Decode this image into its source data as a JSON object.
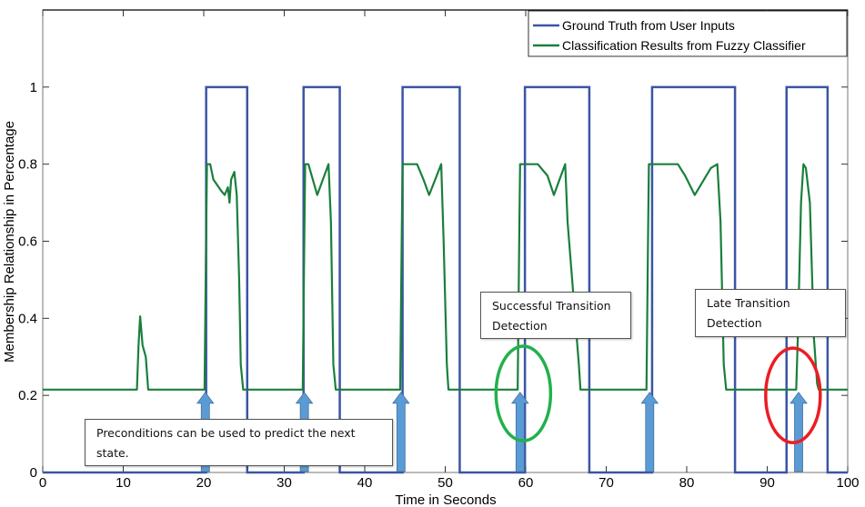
{
  "chart_data": {
    "type": "line",
    "title": "",
    "xlabel": "Time in Seconds",
    "ylabel": "Membership Relationship in Percentage",
    "xlim": [
      0,
      100
    ],
    "ylim": [
      0,
      1.2
    ],
    "xticks": [
      0,
      10,
      20,
      30,
      40,
      50,
      60,
      70,
      80,
      90,
      100
    ],
    "yticks": [
      0,
      0.2,
      0.4,
      0.6,
      0.8,
      1
    ],
    "ytick_labels": [
      "0",
      "0.2",
      "0.4",
      "0.6",
      "0.8",
      "1"
    ],
    "grid": false,
    "legend": {
      "placement": "top-right",
      "entries": [
        {
          "label": "Ground Truth from User Inputs",
          "color": "#3a55a4"
        },
        {
          "label": "Classification Results from Fuzzy Classifier",
          "color": "#1a7f3c"
        }
      ]
    },
    "series": [
      {
        "name": "Ground Truth from User Inputs",
        "color": "#3a55a4",
        "pulses": [
          [
            20.3,
            25.4
          ],
          [
            32.4,
            36.9
          ],
          [
            44.7,
            51.8
          ],
          [
            59.9,
            67.9
          ],
          [
            75.7,
            86.0
          ],
          [
            92.4,
            97.5
          ]
        ],
        "low": 0,
        "high": 1
      },
      {
        "name": "Classification Results from Fuzzy Classifier",
        "color": "#1a7f3c",
        "points": [
          [
            0,
            0.215
          ],
          [
            11.7,
            0.215
          ],
          [
            11.9,
            0.33
          ],
          [
            12.1,
            0.405
          ],
          [
            12.4,
            0.33
          ],
          [
            12.8,
            0.3
          ],
          [
            13.1,
            0.215
          ],
          [
            20.1,
            0.215
          ],
          [
            20.3,
            0.62
          ],
          [
            20.4,
            0.8
          ],
          [
            20.8,
            0.8
          ],
          [
            21.2,
            0.76
          ],
          [
            22.2,
            0.73
          ],
          [
            22.6,
            0.72
          ],
          [
            23.0,
            0.74
          ],
          [
            23.2,
            0.7
          ],
          [
            23.4,
            0.76
          ],
          [
            23.8,
            0.78
          ],
          [
            24.1,
            0.72
          ],
          [
            24.4,
            0.5
          ],
          [
            24.6,
            0.28
          ],
          [
            24.9,
            0.215
          ],
          [
            32.3,
            0.215
          ],
          [
            32.5,
            0.62
          ],
          [
            32.6,
            0.8
          ],
          [
            33.0,
            0.8
          ],
          [
            34.1,
            0.72
          ],
          [
            35.5,
            0.8
          ],
          [
            35.8,
            0.65
          ],
          [
            36.1,
            0.28
          ],
          [
            36.4,
            0.215
          ],
          [
            44.4,
            0.215
          ],
          [
            44.6,
            0.62
          ],
          [
            44.7,
            0.8
          ],
          [
            46.5,
            0.8
          ],
          [
            47.3,
            0.76
          ],
          [
            48.0,
            0.72
          ],
          [
            49.5,
            0.8
          ],
          [
            49.8,
            0.6
          ],
          [
            50.2,
            0.28
          ],
          [
            50.4,
            0.215
          ],
          [
            59.0,
            0.215
          ],
          [
            59.2,
            0.62
          ],
          [
            59.3,
            0.8
          ],
          [
            61.5,
            0.8
          ],
          [
            62.7,
            0.77
          ],
          [
            63.5,
            0.72
          ],
          [
            64.9,
            0.8
          ],
          [
            65.2,
            0.65
          ],
          [
            66.6,
            0.28
          ],
          [
            66.8,
            0.215
          ],
          [
            75.0,
            0.215
          ],
          [
            75.2,
            0.62
          ],
          [
            75.3,
            0.8
          ],
          [
            78.9,
            0.8
          ],
          [
            79.8,
            0.77
          ],
          [
            81.0,
            0.72
          ],
          [
            83.0,
            0.79
          ],
          [
            83.8,
            0.8
          ],
          [
            84.2,
            0.65
          ],
          [
            84.6,
            0.28
          ],
          [
            84.9,
            0.215
          ],
          [
            93.6,
            0.215
          ],
          [
            93.8,
            0.35
          ],
          [
            94.2,
            0.7
          ],
          [
            94.5,
            0.8
          ],
          [
            94.8,
            0.79
          ],
          [
            95.3,
            0.7
          ],
          [
            95.8,
            0.35
          ],
          [
            96.2,
            0.23
          ],
          [
            96.4,
            0.215
          ],
          [
            100,
            0.215
          ]
        ]
      }
    ],
    "annotations": [
      {
        "text": "Preconditions can be used to predict the next state.",
        "kind": "callout-box"
      },
      {
        "text": "Successful Transition Detection",
        "kind": "callout-box"
      },
      {
        "text": "Late Transition Detection",
        "kind": "callout-box"
      }
    ],
    "arrows": {
      "color": "#5b9bd5",
      "x": [
        20.2,
        32.5,
        44.5,
        59.3,
        75.4,
        93.9
      ]
    },
    "highlights": [
      {
        "label": "successful",
        "x": 59.7,
        "y": 0.205,
        "color": "#22b14c"
      },
      {
        "label": "late",
        "x": 93.2,
        "y": 0.2,
        "color": "#ed1c24"
      }
    ]
  },
  "annotations_text": {
    "preconditions_line1": "Preconditions can be used to predict the next",
    "preconditions_line2": "state.",
    "successful_line1": "Successful Transition",
    "successful_line2": "Detection",
    "late_line1": "Late Transition",
    "late_line2": "Detection"
  }
}
